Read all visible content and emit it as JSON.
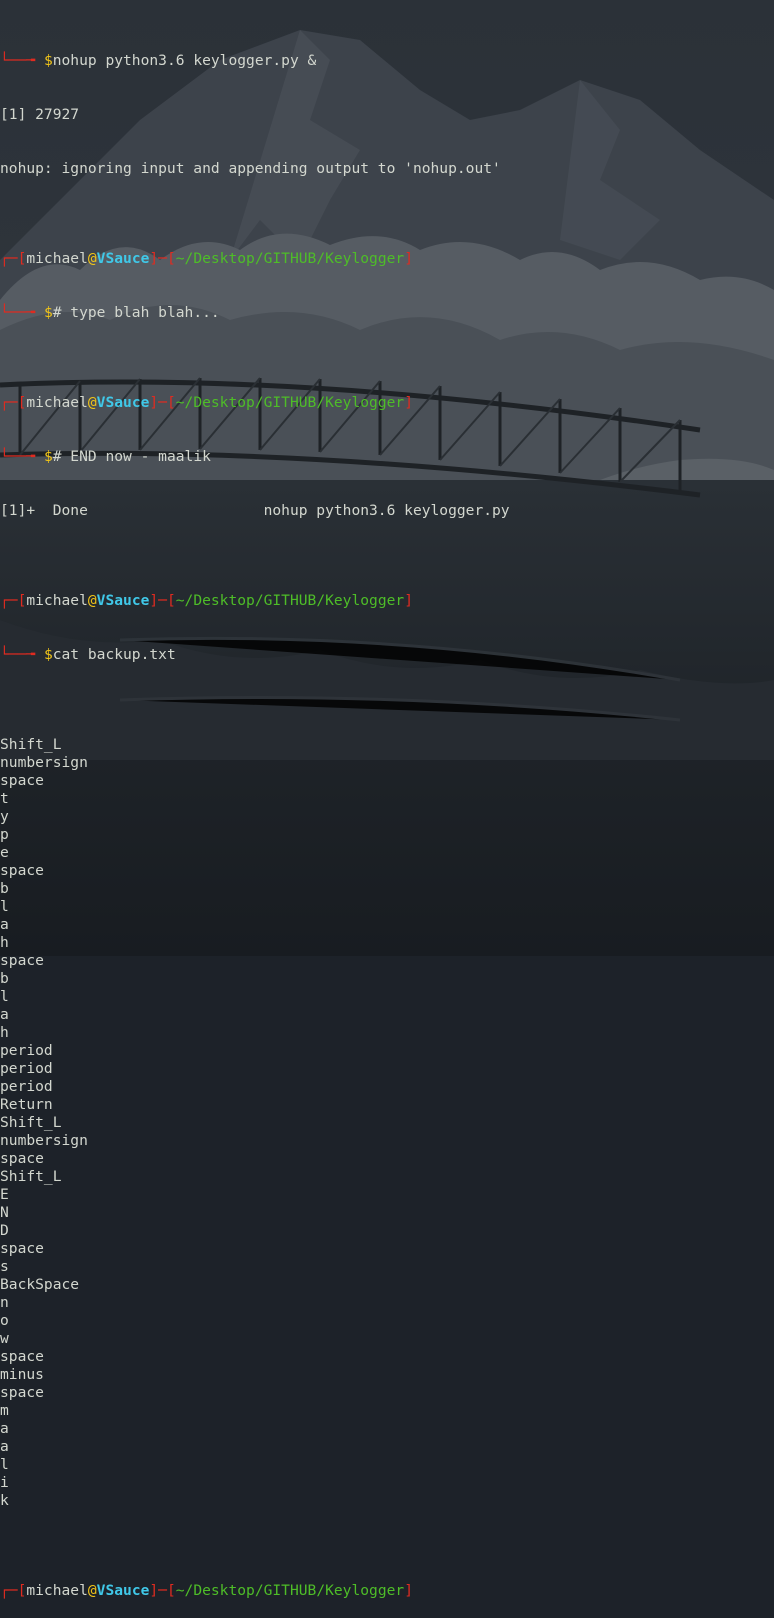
{
  "prompt": {
    "user": "michael",
    "at": "@",
    "host": "VSauce",
    "path": "~/Desktop/GITHUB/Keylogger",
    "tree_top": "┌─[",
    "sep": "]─[",
    "close": "]",
    "tree_bottom": "└──╼ ",
    "dollar": "$"
  },
  "history": {
    "cmd1": "nohup python3.6 keylogger.py &",
    "out1": "[1] 27927",
    "out2": "nohup: ignoring input and appending output to 'nohup.out'",
    "cmd2": "# type blah blah...",
    "cmd3": "# END now - maalik",
    "out3": "[1]+  Done                    nohup python3.6 keylogger.py",
    "cmd4": "cat backup.txt"
  },
  "keystrokes": [
    "Shift_L",
    "numbersign",
    "space",
    "t",
    "y",
    "p",
    "e",
    "space",
    "b",
    "l",
    "a",
    "h",
    "space",
    "b",
    "l",
    "a",
    "h",
    "period",
    "period",
    "period",
    "Return",
    "Shift_L",
    "numbersign",
    "space",
    "Shift_L",
    "E",
    "N",
    "D",
    "space",
    "s",
    "BackSpace",
    "n",
    "o",
    "w",
    "space",
    "minus",
    "space",
    "m",
    "a",
    "a",
    "l",
    "i",
    "k"
  ],
  "colors": {
    "background": "#1d2229",
    "text": "#d3d7cf",
    "bracket": "#e02b20",
    "host": "#40c8e8",
    "path": "#4ebd28",
    "at": "#f0c419"
  },
  "icons": {
    "prompt_arrow": "tree-arrow-icon"
  }
}
